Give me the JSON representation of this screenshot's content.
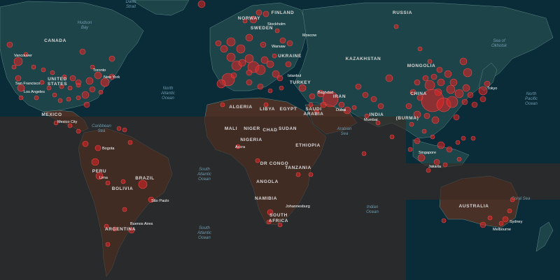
{
  "map": {
    "theme": "dark",
    "colors": {
      "ocean": "#0a2b38",
      "land_north": "#1d4448",
      "land_south": "#4a3127",
      "overlay": "#3c2a24",
      "border": "#5f8a88",
      "case_marker": "#e02323"
    }
  },
  "country_labels": [
    {
      "id": "canada",
      "text": "CANADA"
    },
    {
      "id": "united-states",
      "text": "UNITED"
    },
    {
      "id": "united-states-2",
      "text": "STATES"
    },
    {
      "id": "mexico",
      "text": "MEXICO"
    },
    {
      "id": "brazil",
      "text": "BRAZIL"
    },
    {
      "id": "peru",
      "text": "PERU"
    },
    {
      "id": "bolivia",
      "text": "BOLIVIA"
    },
    {
      "id": "argentina",
      "text": "ARGENTINA"
    },
    {
      "id": "algeria",
      "text": "ALGERIA"
    },
    {
      "id": "libya",
      "text": "LIBYA"
    },
    {
      "id": "egypt",
      "text": "EGYPT"
    },
    {
      "id": "mali",
      "text": "MALI"
    },
    {
      "id": "niger",
      "text": "NIGER"
    },
    {
      "id": "chad",
      "text": "CHAD"
    },
    {
      "id": "sudan",
      "text": "SUDAN"
    },
    {
      "id": "nigeria",
      "text": "NIGERIA"
    },
    {
      "id": "ethiopia",
      "text": "ETHIOPIA"
    },
    {
      "id": "dr-congo",
      "text": "DR CONGO"
    },
    {
      "id": "tanzania",
      "text": "TANZANIA"
    },
    {
      "id": "angola",
      "text": "ANGOLA"
    },
    {
      "id": "namibia",
      "text": "NAMIBIA"
    },
    {
      "id": "south-africa",
      "text": "SOUTH"
    },
    {
      "id": "south-africa-2",
      "text": "AFRICA"
    },
    {
      "id": "norway",
      "text": "NORWAY"
    },
    {
      "id": "sweden",
      "text": "SWEDEN"
    },
    {
      "id": "finland",
      "text": "FINLAND"
    },
    {
      "id": "ukraine",
      "text": "UKRAINE"
    },
    {
      "id": "turkey",
      "text": "TURKEY"
    },
    {
      "id": "iran",
      "text": "IRAN"
    },
    {
      "id": "saudi",
      "text": "SAUDI"
    },
    {
      "id": "arabia",
      "text": "ARABIA"
    },
    {
      "id": "russia",
      "text": "RUSSIA"
    },
    {
      "id": "kazakhstan",
      "text": "KAZAKHSTAN"
    },
    {
      "id": "mongolia",
      "text": "MONGOLIA"
    },
    {
      "id": "china",
      "text": "CHINA"
    },
    {
      "id": "india",
      "text": "INDIA"
    },
    {
      "id": "burma",
      "text": "(BURMA)"
    },
    {
      "id": "australia",
      "text": "AUSTRALIA"
    }
  ],
  "city_labels": [
    {
      "id": "vancouver",
      "text": "Vancouver"
    },
    {
      "id": "toronto",
      "text": "Toronto"
    },
    {
      "id": "new-york",
      "text": "New York"
    },
    {
      "id": "san-francisco",
      "text": "San Francisco"
    },
    {
      "id": "los-angeles",
      "text": "Los Angeles"
    },
    {
      "id": "mexico-city",
      "text": "Mexico City"
    },
    {
      "id": "bogota",
      "text": "Bogota"
    },
    {
      "id": "lima",
      "text": "Lima"
    },
    {
      "id": "sao-paulo",
      "text": "São Paulo"
    },
    {
      "id": "buenos-aires",
      "text": "Buenos Aires"
    },
    {
      "id": "accra",
      "text": "Accra"
    },
    {
      "id": "johannesburg",
      "text": "Johannesburg"
    },
    {
      "id": "stockholm",
      "text": "Stockholm"
    },
    {
      "id": "moscow",
      "text": "Moscow"
    },
    {
      "id": "warsaw",
      "text": "Warsaw"
    },
    {
      "id": "istanbul",
      "text": "Istanbul"
    },
    {
      "id": "baghdad",
      "text": "Baghdad"
    },
    {
      "id": "dubai",
      "text": "Dubai"
    },
    {
      "id": "mumbai",
      "text": "Mumbai"
    },
    {
      "id": "tokyo",
      "text": "Tokyo"
    },
    {
      "id": "singapore",
      "text": "Singapore"
    },
    {
      "id": "jakarta",
      "text": "Jakarta"
    },
    {
      "id": "sydney",
      "text": "Sydney"
    },
    {
      "id": "melbourne",
      "text": "Melbourne"
    }
  ],
  "ocean_labels": [
    {
      "id": "hudson-bay",
      "lines": [
        "Hudson",
        "Bay"
      ]
    },
    {
      "id": "davis-strait",
      "lines": [
        "Davis",
        "Strait"
      ]
    },
    {
      "id": "north-atlantic",
      "lines": [
        "North",
        "Atlantic",
        "Ocean"
      ]
    },
    {
      "id": "caribbean",
      "lines": [
        "Caribbean",
        "Sea"
      ]
    },
    {
      "id": "south-atlantic",
      "lines": [
        "South",
        "Atlantic",
        "Ocean"
      ]
    },
    {
      "id": "south-atlantic-2",
      "lines": [
        "South",
        "Atlantic",
        "Ocean"
      ]
    },
    {
      "id": "arabian-sea",
      "lines": [
        "Arabian",
        "Sea"
      ]
    },
    {
      "id": "indian-ocean",
      "lines": [
        "Indian",
        "Ocean"
      ]
    },
    {
      "id": "sea-of-okhotsk",
      "lines": [
        "Sea of",
        "Okhotsk"
      ]
    },
    {
      "id": "north-pacific",
      "lines": [
        "North",
        "Pacific",
        "Ocean"
      ]
    },
    {
      "id": "coral-sea",
      "lines": [
        "Coral Sea"
      ]
    }
  ]
}
